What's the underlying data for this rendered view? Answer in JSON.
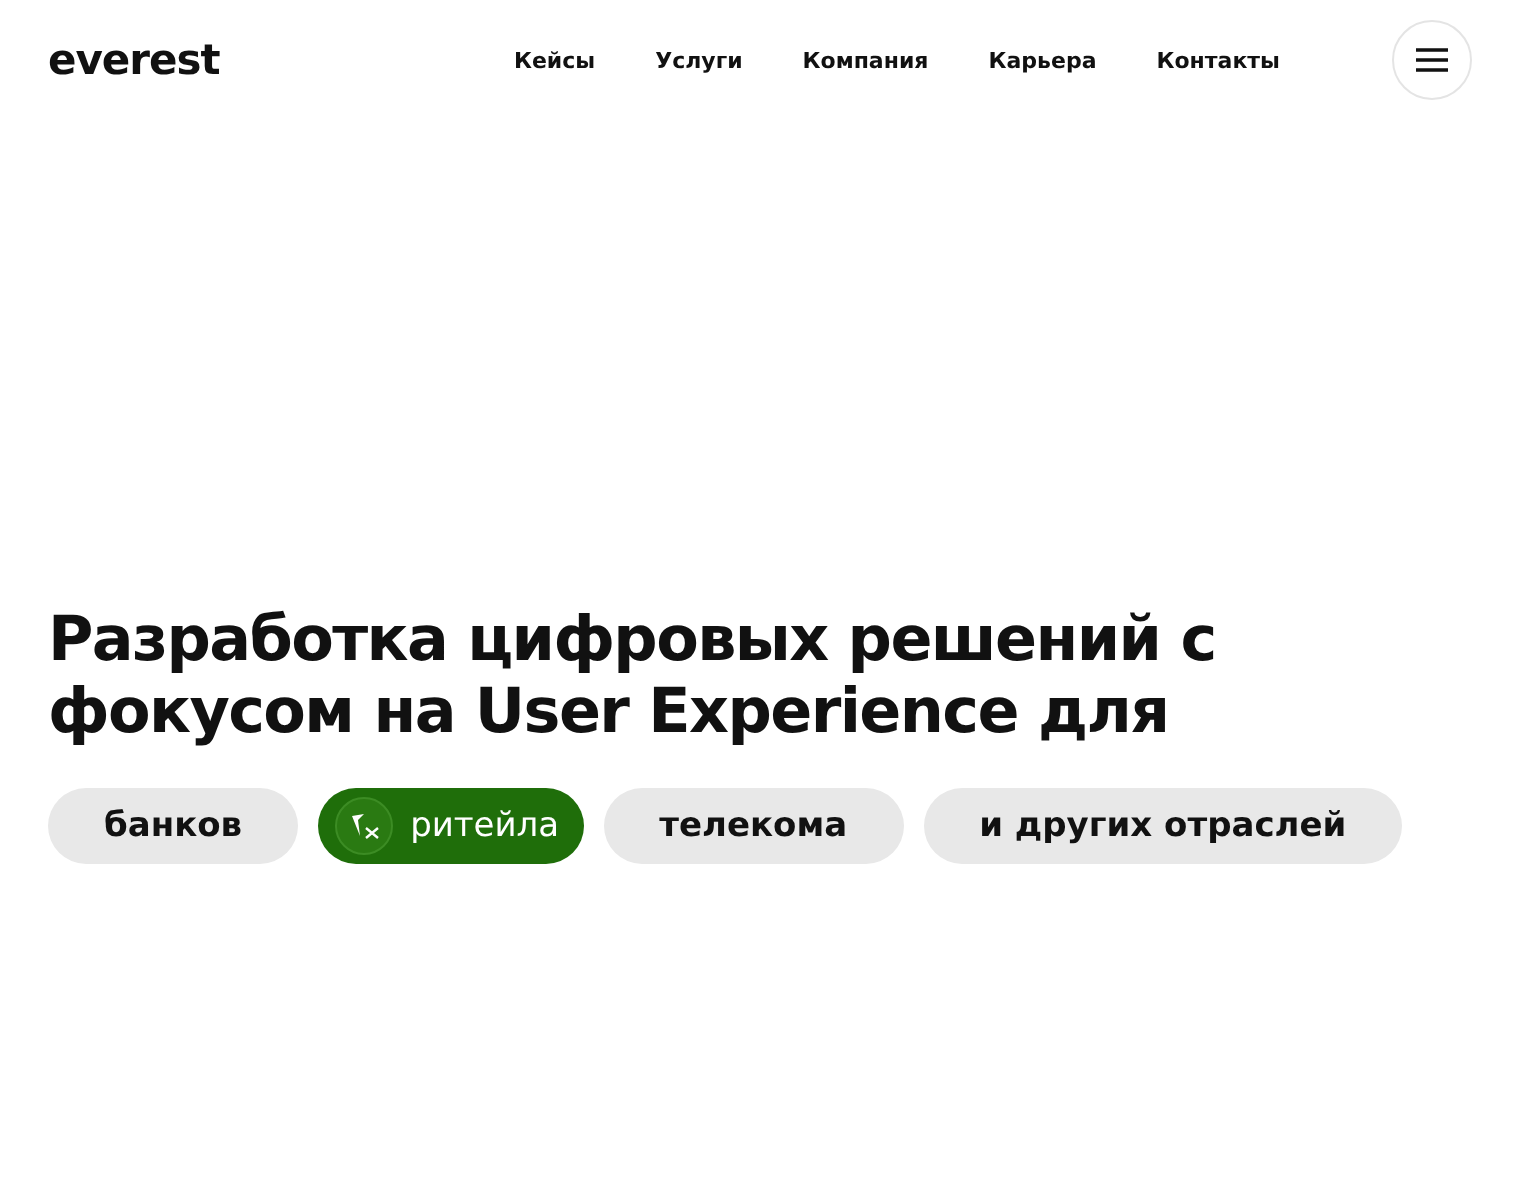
{
  "logo": "everest",
  "nav": [
    {
      "label": "Кейсы"
    },
    {
      "label": "Услуги"
    },
    {
      "label": "Компания"
    },
    {
      "label": "Карьера"
    },
    {
      "label": "Контакты"
    }
  ],
  "headline": "Разработка цифровых решений с фокусом на User Experience для",
  "industries": [
    {
      "label": "банков",
      "selected": false
    },
    {
      "label": "ритейла",
      "selected": true
    },
    {
      "label": "телекома",
      "selected": false
    },
    {
      "label": "и других отраслей",
      "selected": false
    }
  ]
}
